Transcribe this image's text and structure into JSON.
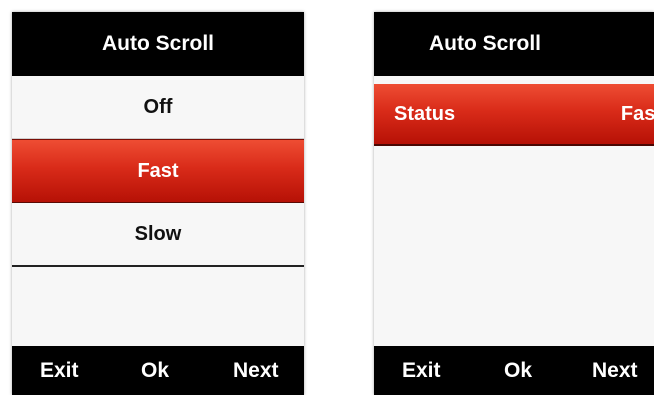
{
  "left_screen": {
    "title": "Auto Scroll",
    "options": [
      {
        "label": "Off",
        "selected": false
      },
      {
        "label": "Fast",
        "selected": true
      },
      {
        "label": "Slow",
        "selected": false
      }
    ],
    "softkeys": {
      "exit": "Exit",
      "ok": "Ok",
      "next": "Next"
    }
  },
  "right_screen": {
    "title": "Auto Scroll",
    "status_label": "Status",
    "status_value": "Fast",
    "softkeys": {
      "exit": "Exit",
      "ok": "Ok",
      "next": "Next"
    }
  },
  "colors": {
    "title_bar": "#000000",
    "highlight_top": "#ee4d33",
    "highlight_bottom": "#b61106",
    "background": "#f7f7f7"
  }
}
